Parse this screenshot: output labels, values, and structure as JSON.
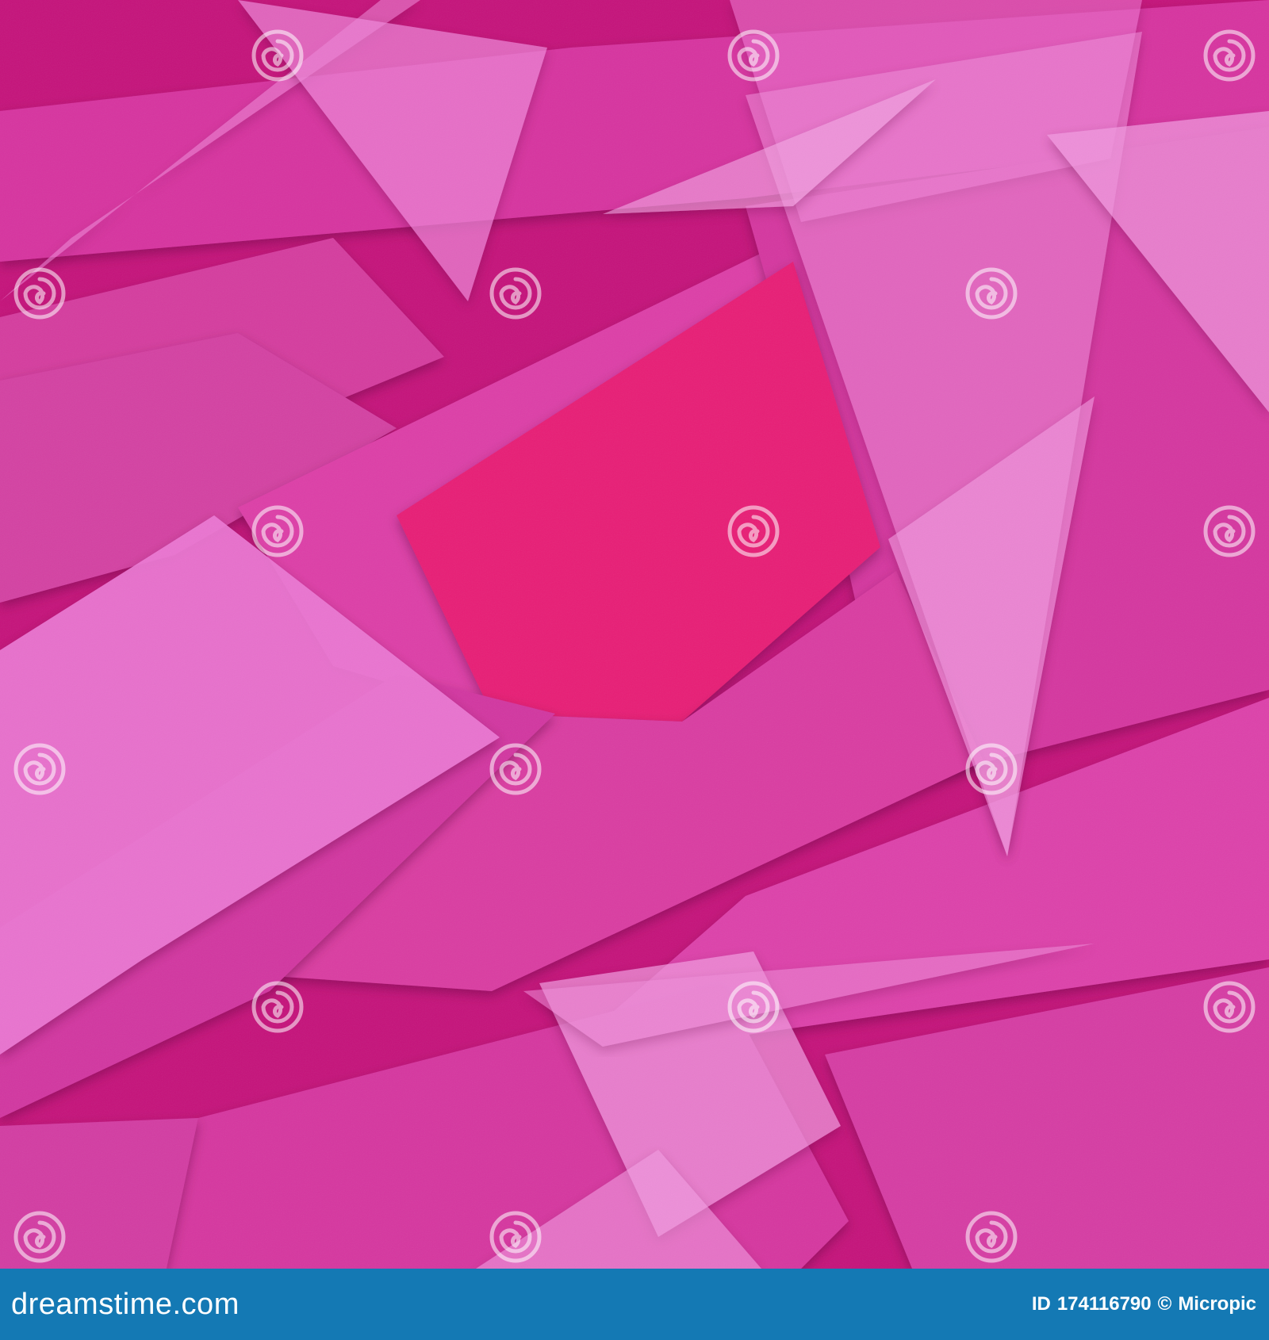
{
  "image": {
    "description_kind": "abstract geometric background",
    "colors": {
      "base": "#c5117a",
      "magenta": "#d7339f",
      "pink_dark": "#c01670",
      "pink_hot": "#e81f74",
      "pink_light": "#ec78d4",
      "pink_pale": "#f19ae0",
      "footer": "#1479b4"
    }
  },
  "watermark": {
    "text": "dreamstime",
    "icon": "spiral-logo-icon"
  },
  "footer": {
    "brand": "dreamstime.com",
    "id_label": "ID",
    "id_value": "174116790",
    "copyright_symbol": "©",
    "author": "Micropic"
  }
}
